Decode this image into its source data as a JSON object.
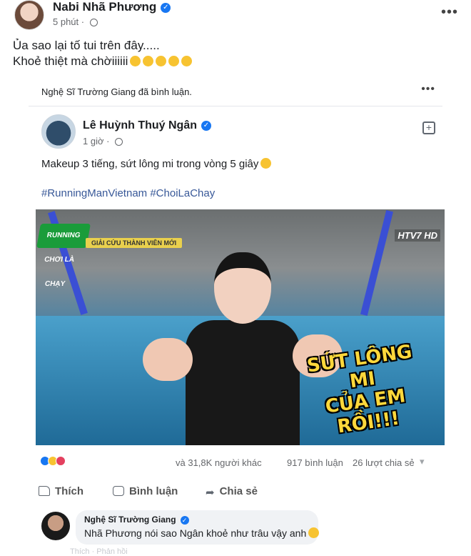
{
  "post": {
    "author": "Nabi Nhã Phương",
    "time": "5 phút",
    "line1": "Ủa sao lại tố tui trên đây.....",
    "line2": "Khoẻ thiệt mà chờiiiiii",
    "emoji_icon": "sad-face-emoji",
    "more_icon": "•••"
  },
  "shared": {
    "header_text": "Nghệ Sĩ Trường Giang đã bình luận.",
    "more_icon": "•••",
    "author": "Lê Huỳnh Thuý Ngân",
    "time": "1 giờ",
    "text": "Makeup 3 tiếng, sứt lông mi trong vòng 5 giây",
    "hashtag1": "#RunningManVietnam",
    "hashtag2": "#ChoiLaChay",
    "video": {
      "logo_text": "RUNNING CHƠI LÀ CHẠY",
      "banner_text": "GIẢI CỨU THÀNH VIÊN MỚI",
      "channel": "HTV7 HD",
      "caption_line1": "SỨT LÔNG MI",
      "caption_line2": "CỦA EM RỒI!!!"
    },
    "reactions": {
      "count_text": "và 31,8K người khác",
      "comments_text": "917 bình luận",
      "shares_text": "26 lượt chia sẻ",
      "types": [
        "like",
        "haha",
        "love"
      ]
    },
    "actions": {
      "like": "Thích",
      "comment": "Bình luận",
      "share": "Chia sẻ"
    },
    "comment": {
      "author": "Nghệ Sĩ Trường Giang",
      "text": "Nhã Phương nói sao Ngân khoẻ như trâu vậy anh",
      "faded_text": "Thích · Phản hồi"
    }
  },
  "colors": {
    "link": "#385898",
    "verified": "#1877f2",
    "muted": "#65676b",
    "bubble": "#f0f2f5"
  }
}
